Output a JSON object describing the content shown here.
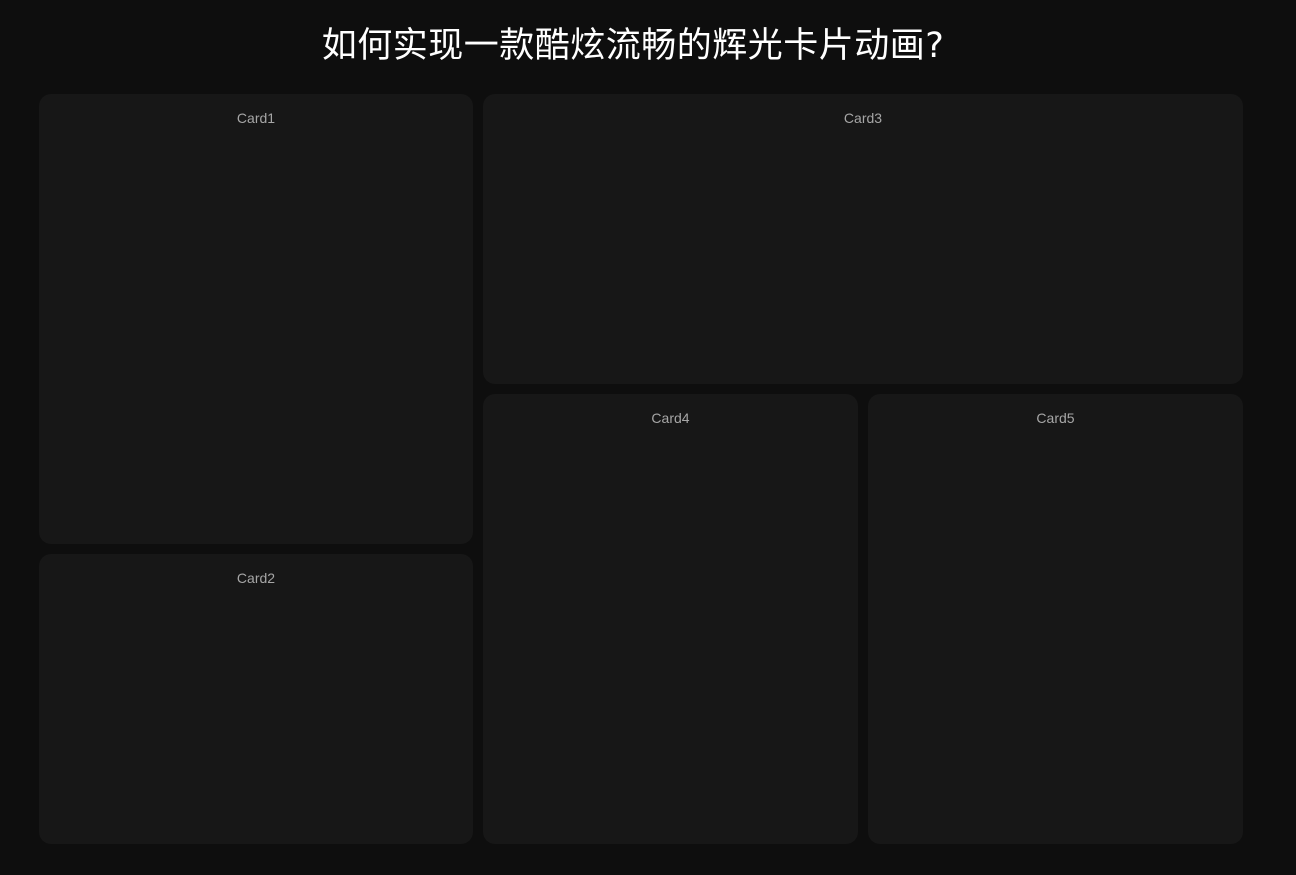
{
  "page": {
    "title": "如何实现一款酷炫流畅的辉光卡片动画?"
  },
  "cards": [
    {
      "label": "Card1"
    },
    {
      "label": "Card2"
    },
    {
      "label": "Card3"
    },
    {
      "label": "Card4"
    },
    {
      "label": "Card5"
    }
  ],
  "colors": {
    "background": "#0e0e0e",
    "card": "#171717",
    "title": "#ffffff",
    "card_label": "#a6a6a6"
  }
}
